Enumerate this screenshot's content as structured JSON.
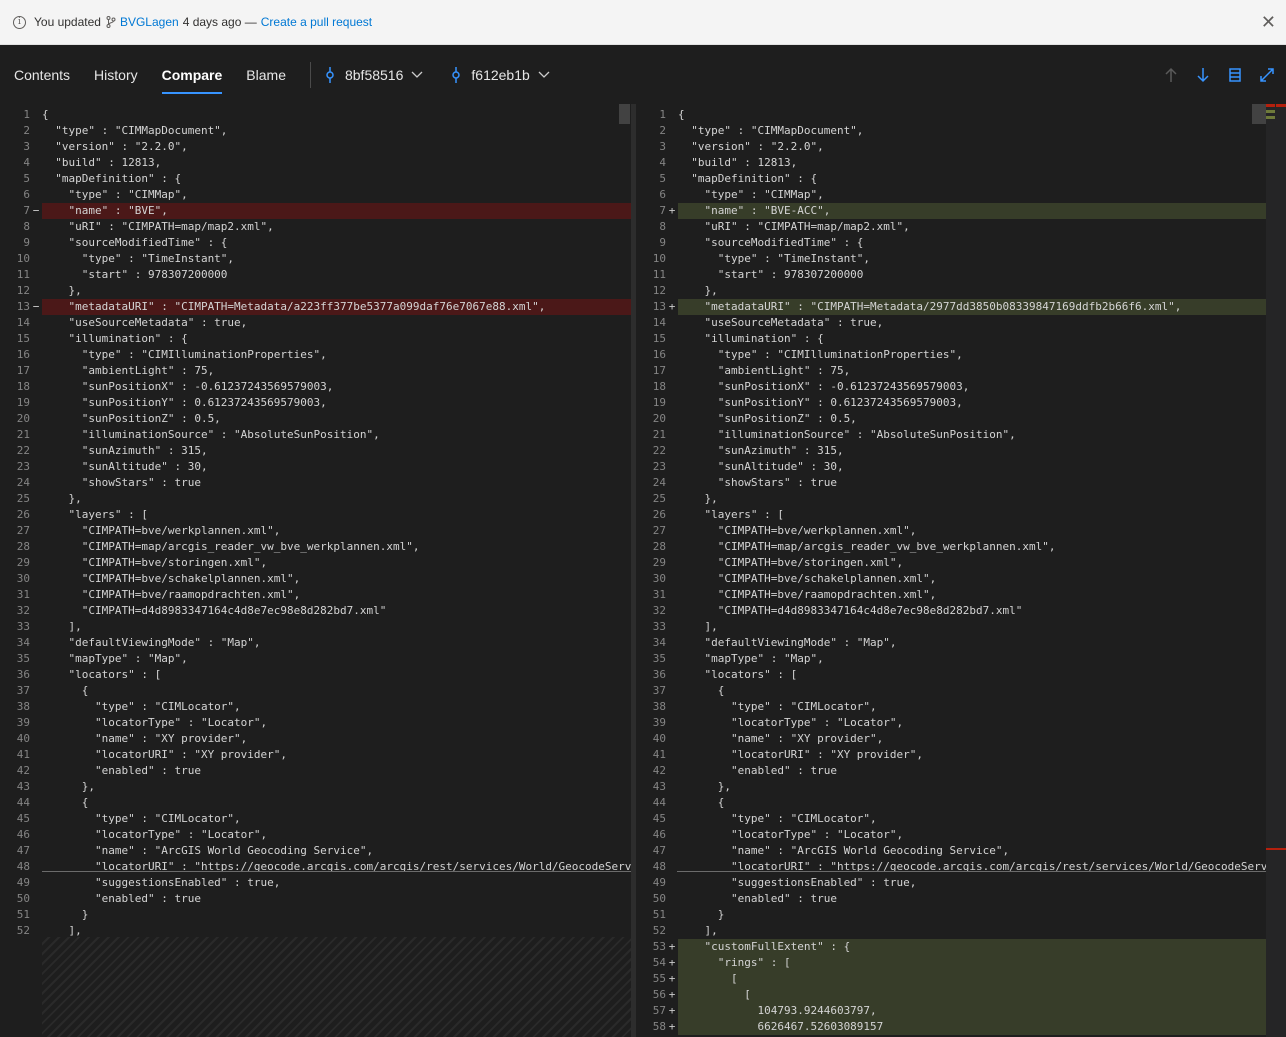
{
  "notification": {
    "prefix": "You updated",
    "branch": "BVGLagen",
    "when": "4 days ago —",
    "action": "Create a pull request"
  },
  "tabs": [
    {
      "label": "Contents"
    },
    {
      "label": "History"
    },
    {
      "label": "Compare",
      "active": true
    },
    {
      "label": "Blame"
    }
  ],
  "commits": {
    "base": "8bf58516",
    "target": "f612eb1b"
  },
  "colors": {
    "accent": "#3794ff",
    "deleted": "#4b1818",
    "added": "#373d29",
    "link": "#0078d4"
  },
  "left_lines": [
    {
      "n": "1",
      "t": "{"
    },
    {
      "n": "2",
      "t": "  \"type\" : \"CIMMapDocument\","
    },
    {
      "n": "3",
      "t": "  \"version\" : \"2.2.0\","
    },
    {
      "n": "4",
      "t": "  \"build\" : 12813,"
    },
    {
      "n": "5",
      "t": "  \"mapDefinition\" : {"
    },
    {
      "n": "6",
      "t": "    \"type\" : \"CIMMap\","
    },
    {
      "n": "7",
      "t": "    \"name\" : \"BVE\",",
      "k": "del"
    },
    {
      "n": "8",
      "t": "    \"uRI\" : \"CIMPATH=map/map2.xml\","
    },
    {
      "n": "9",
      "t": "    \"sourceModifiedTime\" : {"
    },
    {
      "n": "10",
      "t": "      \"type\" : \"TimeInstant\","
    },
    {
      "n": "11",
      "t": "      \"start\" : 978307200000"
    },
    {
      "n": "12",
      "t": "    },"
    },
    {
      "n": "13",
      "t": "    \"metadataURI\" : \"CIMPATH=Metadata/a223ff377be5377a099daf76e7067e88.xml\",",
      "k": "del"
    },
    {
      "n": "14",
      "t": "    \"useSourceMetadata\" : true,"
    },
    {
      "n": "15",
      "t": "    \"illumination\" : {"
    },
    {
      "n": "16",
      "t": "      \"type\" : \"CIMIlluminationProperties\","
    },
    {
      "n": "17",
      "t": "      \"ambientLight\" : 75,"
    },
    {
      "n": "18",
      "t": "      \"sunPositionX\" : -0.61237243569579003,"
    },
    {
      "n": "19",
      "t": "      \"sunPositionY\" : 0.61237243569579003,"
    },
    {
      "n": "20",
      "t": "      \"sunPositionZ\" : 0.5,"
    },
    {
      "n": "21",
      "t": "      \"illuminationSource\" : \"AbsoluteSunPosition\","
    },
    {
      "n": "22",
      "t": "      \"sunAzimuth\" : 315,"
    },
    {
      "n": "23",
      "t": "      \"sunAltitude\" : 30,"
    },
    {
      "n": "24",
      "t": "      \"showStars\" : true"
    },
    {
      "n": "25",
      "t": "    },"
    },
    {
      "n": "26",
      "t": "    \"layers\" : ["
    },
    {
      "n": "27",
      "t": "      \"CIMPATH=bve/werkplannen.xml\","
    },
    {
      "n": "28",
      "t": "      \"CIMPATH=map/arcgis_reader_vw_bve_werkplannen.xml\","
    },
    {
      "n": "29",
      "t": "      \"CIMPATH=bve/storingen.xml\","
    },
    {
      "n": "30",
      "t": "      \"CIMPATH=bve/schakelplannen.xml\","
    },
    {
      "n": "31",
      "t": "      \"CIMPATH=bve/raamopdrachten.xml\","
    },
    {
      "n": "32",
      "t": "      \"CIMPATH=d4d8983347164c4d8e7ec98e8d282bd7.xml\""
    },
    {
      "n": "33",
      "t": "    ],"
    },
    {
      "n": "34",
      "t": "    \"defaultViewingMode\" : \"Map\","
    },
    {
      "n": "35",
      "t": "    \"mapType\" : \"Map\","
    },
    {
      "n": "36",
      "t": "    \"locators\" : ["
    },
    {
      "n": "37",
      "t": "      {"
    },
    {
      "n": "38",
      "t": "        \"type\" : \"CIMLocator\","
    },
    {
      "n": "39",
      "t": "        \"locatorType\" : \"Locator\","
    },
    {
      "n": "40",
      "t": "        \"name\" : \"XY provider\","
    },
    {
      "n": "41",
      "t": "        \"locatorURI\" : \"XY provider\","
    },
    {
      "n": "42",
      "t": "        \"enabled\" : true"
    },
    {
      "n": "43",
      "t": "      },"
    },
    {
      "n": "44",
      "t": "      {"
    },
    {
      "n": "45",
      "t": "        \"type\" : \"CIMLocator\","
    },
    {
      "n": "46",
      "t": "        \"locatorType\" : \"Locator\","
    },
    {
      "n": "47",
      "t": "        \"name\" : \"ArcGIS World Geocoding Service\","
    },
    {
      "n": "48",
      "t": "        \"locatorURI\" : \"https://geocode.arcgis.com/arcgis/rest/services/World/GeocodeServer\","
    },
    {
      "n": "49",
      "t": "        \"suggestionsEnabled\" : true,"
    },
    {
      "n": "50",
      "t": "        \"enabled\" : true"
    },
    {
      "n": "51",
      "t": "      }"
    },
    {
      "n": "52",
      "t": "    ],"
    }
  ],
  "right_lines": [
    {
      "n": "1",
      "t": "{"
    },
    {
      "n": "2",
      "t": "  \"type\" : \"CIMMapDocument\","
    },
    {
      "n": "3",
      "t": "  \"version\" : \"2.2.0\","
    },
    {
      "n": "4",
      "t": "  \"build\" : 12813,"
    },
    {
      "n": "5",
      "t": "  \"mapDefinition\" : {"
    },
    {
      "n": "6",
      "t": "    \"type\" : \"CIMMap\","
    },
    {
      "n": "7",
      "t": "    \"name\" : \"BVE-ACC\",",
      "k": "add"
    },
    {
      "n": "8",
      "t": "    \"uRI\" : \"CIMPATH=map/map2.xml\","
    },
    {
      "n": "9",
      "t": "    \"sourceModifiedTime\" : {"
    },
    {
      "n": "10",
      "t": "      \"type\" : \"TimeInstant\","
    },
    {
      "n": "11",
      "t": "      \"start\" : 978307200000"
    },
    {
      "n": "12",
      "t": "    },"
    },
    {
      "n": "13",
      "t": "    \"metadataURI\" : \"CIMPATH=Metadata/2977dd3850b08339847169ddfb2b66f6.xml\",",
      "k": "add"
    },
    {
      "n": "14",
      "t": "    \"useSourceMetadata\" : true,"
    },
    {
      "n": "15",
      "t": "    \"illumination\" : {"
    },
    {
      "n": "16",
      "t": "      \"type\" : \"CIMIlluminationProperties\","
    },
    {
      "n": "17",
      "t": "      \"ambientLight\" : 75,"
    },
    {
      "n": "18",
      "t": "      \"sunPositionX\" : -0.61237243569579003,"
    },
    {
      "n": "19",
      "t": "      \"sunPositionY\" : 0.61237243569579003,"
    },
    {
      "n": "20",
      "t": "      \"sunPositionZ\" : 0.5,"
    },
    {
      "n": "21",
      "t": "      \"illuminationSource\" : \"AbsoluteSunPosition\","
    },
    {
      "n": "22",
      "t": "      \"sunAzimuth\" : 315,"
    },
    {
      "n": "23",
      "t": "      \"sunAltitude\" : 30,"
    },
    {
      "n": "24",
      "t": "      \"showStars\" : true"
    },
    {
      "n": "25",
      "t": "    },"
    },
    {
      "n": "26",
      "t": "    \"layers\" : ["
    },
    {
      "n": "27",
      "t": "      \"CIMPATH=bve/werkplannen.xml\","
    },
    {
      "n": "28",
      "t": "      \"CIMPATH=map/arcgis_reader_vw_bve_werkplannen.xml\","
    },
    {
      "n": "29",
      "t": "      \"CIMPATH=bve/storingen.xml\","
    },
    {
      "n": "30",
      "t": "      \"CIMPATH=bve/schakelplannen.xml\","
    },
    {
      "n": "31",
      "t": "      \"CIMPATH=bve/raamopdrachten.xml\","
    },
    {
      "n": "32",
      "t": "      \"CIMPATH=d4d8983347164c4d8e7ec98e8d282bd7.xml\""
    },
    {
      "n": "33",
      "t": "    ],"
    },
    {
      "n": "34",
      "t": "    \"defaultViewingMode\" : \"Map\","
    },
    {
      "n": "35",
      "t": "    \"mapType\" : \"Map\","
    },
    {
      "n": "36",
      "t": "    \"locators\" : ["
    },
    {
      "n": "37",
      "t": "      {"
    },
    {
      "n": "38",
      "t": "        \"type\" : \"CIMLocator\","
    },
    {
      "n": "39",
      "t": "        \"locatorType\" : \"Locator\","
    },
    {
      "n": "40",
      "t": "        \"name\" : \"XY provider\","
    },
    {
      "n": "41",
      "t": "        \"locatorURI\" : \"XY provider\","
    },
    {
      "n": "42",
      "t": "        \"enabled\" : true"
    },
    {
      "n": "43",
      "t": "      },"
    },
    {
      "n": "44",
      "t": "      {"
    },
    {
      "n": "45",
      "t": "        \"type\" : \"CIMLocator\","
    },
    {
      "n": "46",
      "t": "        \"locatorType\" : \"Locator\","
    },
    {
      "n": "47",
      "t": "        \"name\" : \"ArcGIS World Geocoding Service\","
    },
    {
      "n": "48",
      "t": "        \"locatorURI\" : \"https://geocode.arcgis.com/arcgis/rest/services/World/GeocodeServer\","
    },
    {
      "n": "49",
      "t": "        \"suggestionsEnabled\" : true,"
    },
    {
      "n": "50",
      "t": "        \"enabled\" : true"
    },
    {
      "n": "51",
      "t": "      }"
    },
    {
      "n": "52",
      "t": "    ],"
    },
    {
      "n": "53",
      "t": "    \"customFullExtent\" : {",
      "k": "add"
    },
    {
      "n": "54",
      "t": "      \"rings\" : [",
      "k": "add"
    },
    {
      "n": "55",
      "t": "        [",
      "k": "add"
    },
    {
      "n": "56",
      "t": "          [",
      "k": "add"
    },
    {
      "n": "57",
      "t": "            104793.9244603797,",
      "k": "add"
    },
    {
      "n": "58",
      "t": "            6626467.52603089157",
      "k": "add"
    }
  ],
  "markers": {
    "del": "−",
    "add": "+"
  }
}
